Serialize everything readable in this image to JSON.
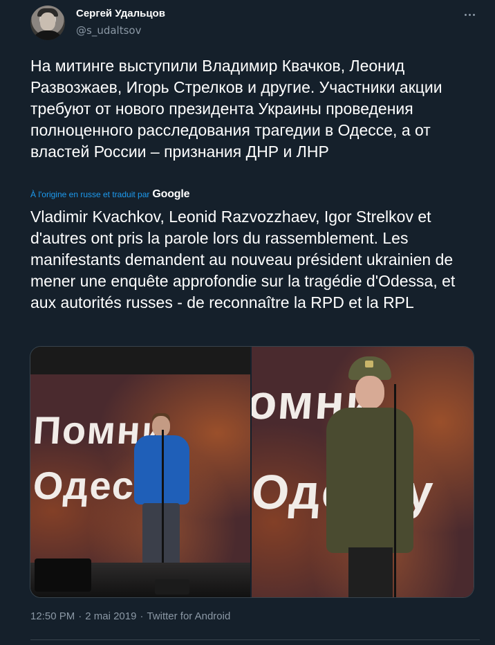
{
  "author": {
    "display_name": "Сергей Удальцов",
    "handle": "@s_udaltsov"
  },
  "icons": {
    "more": "more-horizontal-icon",
    "avatar": "avatar-photo"
  },
  "tweet": {
    "text_original": "На митинге выступили Владимир Квачков, Леонид Развозжаев, Игорь Стрелков и другие. Участники акции требуют от нового президента Украины проведения полноценного расследования трагедии в Одессе, а от властей России – признания ДНР и ЛНР",
    "translation_note": "À l'origine en russe et traduit par",
    "translation_provider": "Google",
    "text_translated": "Vladimir Kvachkov, Leonid Razvozzhaev, Igor Strelkov et d'autres ont pris la parole lors du rassemblement. Les manifestants demandent au nouveau président ukrainien de mener une enquête approfondie sur la tragédie d'Odessa, et aux autorités russes - de reconnaître la RPD et la RPL"
  },
  "media": {
    "photo_left": {
      "banner_line1": "Помни",
      "banner_line2": "Одессу"
    },
    "photo_right": {
      "banner_line1": "омни",
      "banner_line2": "Одессу"
    }
  },
  "meta": {
    "time": "12:50 PM",
    "separator": "·",
    "date": "2 mai 2019",
    "source": "Twitter for Android"
  },
  "colors": {
    "background": "#15202b",
    "text": "#ffffff",
    "secondary_text": "#8b98a5",
    "accent": "#1d9bf0",
    "border": "#38444d"
  }
}
